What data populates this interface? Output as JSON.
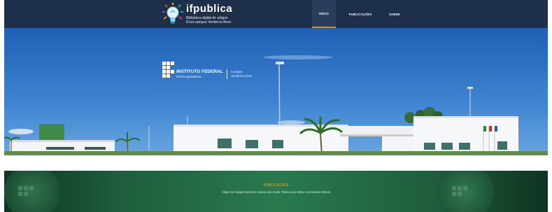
{
  "header": {
    "brand_title": "ifpublica",
    "brand_subtitle_1": "Biblioteca digital de artigos",
    "brand_subtitle_2": "IFsul campus Venâncio Aires",
    "nav": [
      "INÍCIO",
      "PUBLICAÇÕES",
      "SOBRE"
    ]
  },
  "hero": {
    "institution_name": "INSTITUTO FEDERAL",
    "institution_sub": "Sul-rio-grandense",
    "campus_line_1": "Campus",
    "campus_line_2": "Venâncio Aires"
  },
  "publications": {
    "title": "PUBLICAÇÕES",
    "description": "Clique na imagem para ter acesso aos Anais. Tenha uma ótima e proveitosa leitura!"
  },
  "colors": {
    "navbar": "#1e2f4a",
    "active_underline": "#e08a1e",
    "sky": "#2f6fc0",
    "footer_green": "#1f6b45",
    "publications_title": "#e8a536"
  },
  "icons": [
    "lightbulb-logo-icon",
    "if-grid-logo-icon"
  ]
}
